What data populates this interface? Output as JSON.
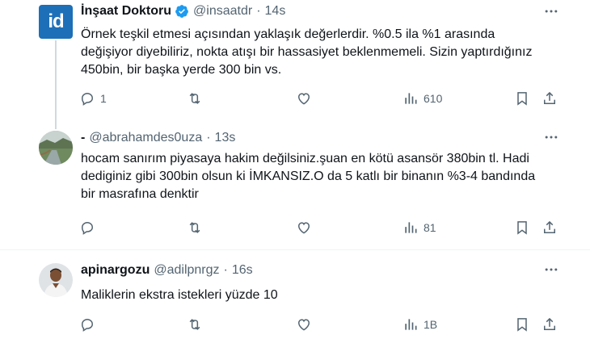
{
  "tweets": [
    {
      "name": "İnşaat Doktoru",
      "handle": "@insaatdr",
      "dot": "·",
      "time": "14s",
      "avatar_text": "id",
      "text": "Örnek teşkil etmesi açısından yaklaşık değerlerdir. %0.5 ila %1 arasında değişiyor diyebiliriz, nokta atışı bir hassasiyet beklenmemeli. Sizin yaptırdığınız 450bin, bir başka yerde 300 bin vs.",
      "replies": "1",
      "retweets": "",
      "likes": "",
      "views": "610"
    },
    {
      "name": "-",
      "handle": "@abrahamdes0uza",
      "dot": "·",
      "time": "13s",
      "text": "hocam sanırım piyasaya hakim değilsiniz.şuan en kötü asansör 380bin tl. Hadi dediginiz gibi 300bin olsun ki İMKANSIZ.O da 5 katlı bir binanın %3-4 bandında bir masrafına denktir",
      "replies": "",
      "retweets": "",
      "likes": "",
      "views": "81"
    },
    {
      "name": "apinargozu",
      "handle": "@adilpnrgz",
      "dot": "·",
      "time": "16s",
      "text": "Maliklerin ekstra istekleri yüzde 10",
      "replies": "",
      "retweets": "",
      "likes": "",
      "views": "1B"
    }
  ],
  "colors": {
    "verified": "#1d9bf0",
    "muted": "#536471",
    "text": "#0f1419",
    "divider": "#eff3f4",
    "thread": "#cfd9de"
  },
  "icons": [
    "reply-icon",
    "retweet-icon",
    "like-icon",
    "views-icon",
    "bookmark-icon",
    "share-icon",
    "more-icon",
    "verified-icon"
  ]
}
